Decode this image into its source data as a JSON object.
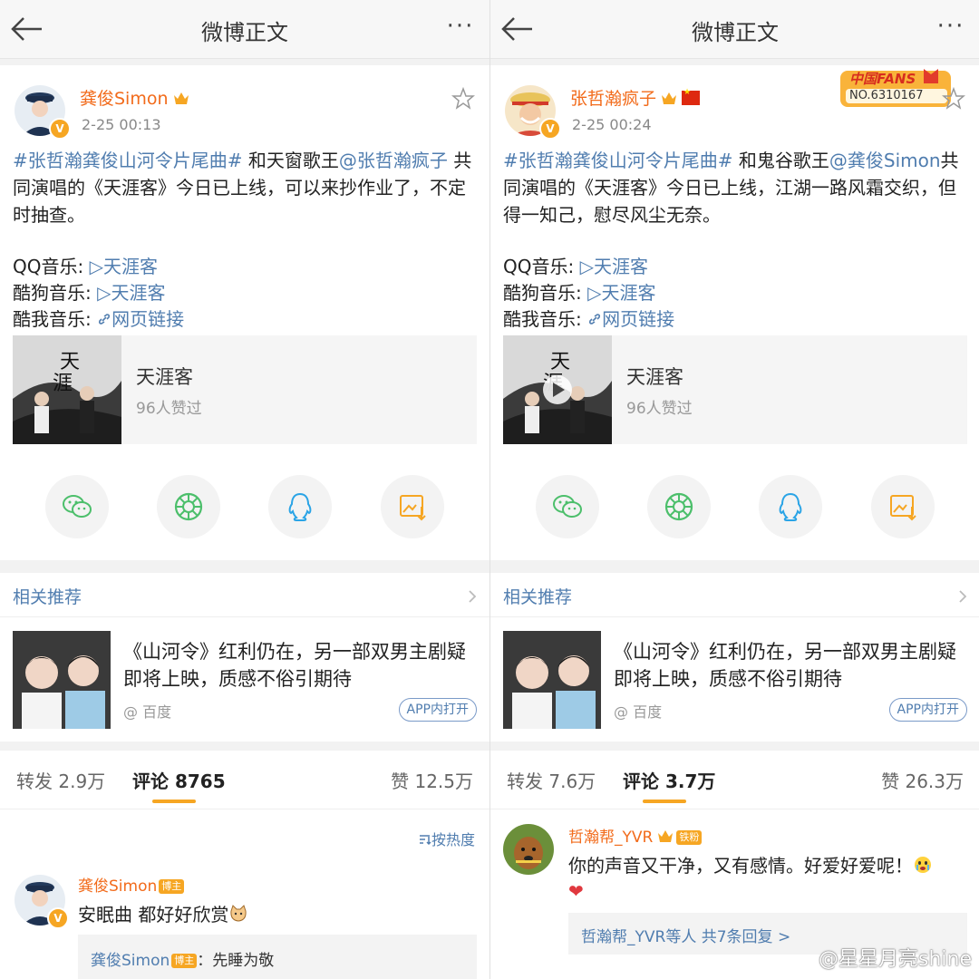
{
  "header": {
    "title": "微博正文",
    "more": "···"
  },
  "left": {
    "author": "龚俊Simon",
    "time": "2-25 00:13",
    "verified": "V",
    "text_topic": "#张哲瀚龚俊山河令片尾曲#",
    "text_mid": " 和天窗歌王",
    "text_mention": "@张哲瀚疯子",
    "text_rest": " 共同演唱的《天涯客》今日已上线，可以来抄作业了，不定时抽查。",
    "music": [
      {
        "platform": "QQ音乐: ",
        "link": "▷天涯客"
      },
      {
        "platform": "酷狗音乐: ",
        "link": "▷天涯客"
      },
      {
        "platform": "酷我音乐: ",
        "link": "网页链接"
      }
    ],
    "card": {
      "title": "天涯客",
      "likes": "96人赞过"
    },
    "related": {
      "header": "相关推荐",
      "title": "《山河令》红利仍在，另一部双男主剧疑即将上映，质感不俗引期待",
      "source": "@ 百度",
      "open": "APP内打开"
    },
    "tabs": {
      "forward": "转发 2.9万",
      "comment": "评论 8765",
      "like": "赞 12.5万"
    },
    "sort": "按热度",
    "comment": {
      "name": "龚俊Simon",
      "tag": "博主",
      "text": "安眠曲 都好好欣赏",
      "reply_name": "龚俊Simon",
      "reply_tag": "博主",
      "reply_text": "：先睡为敬"
    }
  },
  "right": {
    "author": "张哲瀚疯子",
    "time": "2-25 00:24",
    "verified": "V",
    "fans_badge": {
      "brand": "中国FANS",
      "number": "NO.6310167"
    },
    "text_topic": "#张哲瀚龚俊山河令片尾曲#",
    "text_mid": " 和鬼谷歌王",
    "text_mention": "@龚俊Simon",
    "text_rest": "共同演唱的《天涯客》今日已上线，江湖一路风霜交织，但得一知己，慰尽风尘无奈。",
    "music": [
      {
        "platform": "QQ音乐: ",
        "link": "▷天涯客"
      },
      {
        "platform": "酷狗音乐: ",
        "link": "▷天涯客"
      },
      {
        "platform": "酷我音乐: ",
        "link": "网页链接"
      }
    ],
    "card": {
      "title": "天涯客",
      "likes": "96人赞过"
    },
    "related": {
      "header": "相关推荐",
      "title": "《山河令》红利仍在，另一部双男主剧疑即将上映，质感不俗引期待",
      "source": "@ 百度",
      "open": "APP内打开"
    },
    "tabs": {
      "forward": "转发 7.6万",
      "comment": "评论 3.7万",
      "like": "赞 26.3万"
    },
    "comment": {
      "name": "哲瀚帮_YVR",
      "tag": "铁粉",
      "text": "你的声音又干净，又有感情。好爱好爱呢！",
      "heart": "❤",
      "reply_summary": "哲瀚帮_YVR等人",
      "reply_count": "共7条回复 >"
    }
  },
  "watermark": "@星星月亮shine",
  "colors": {
    "link": "#507daf",
    "username": "#f26b1b",
    "accent": "#f6a623"
  }
}
